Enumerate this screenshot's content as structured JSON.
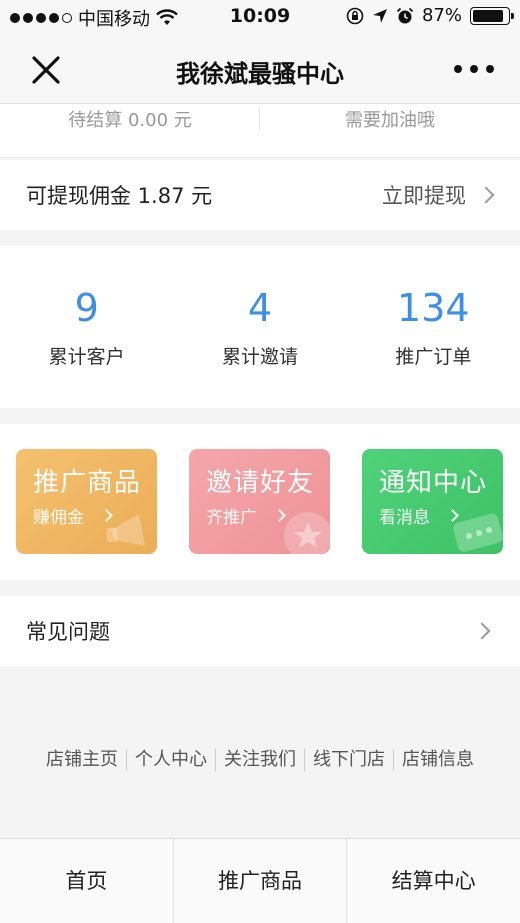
{
  "status_bar": {
    "carrier": "中国移动",
    "time": "10:09",
    "battery": "87%",
    "battery_level": 0.87
  },
  "nav": {
    "title": "我徐斌最骚中心"
  },
  "top_row": {
    "left_text": "待结算 0.00 元",
    "right_text": "需要加油哦"
  },
  "withdraw": {
    "label": "可提现佣金 1.87 元",
    "action": "立即提现"
  },
  "stats": [
    {
      "value": "9",
      "label": "累计客户"
    },
    {
      "value": "4",
      "label": "累计邀请"
    },
    {
      "value": "134",
      "label": "推广订单"
    }
  ],
  "cards": [
    {
      "title": "推广商品",
      "sub": "赚佣金",
      "color": "#efb760"
    },
    {
      "title": "邀请好友",
      "sub": "齐推广",
      "color": "#f29ca0"
    },
    {
      "title": "通知中心",
      "sub": "看消息",
      "color": "#46ca6f"
    }
  ],
  "faq": {
    "label": "常见问题"
  },
  "footer_links": [
    "店铺主页",
    "个人中心",
    "关注我们",
    "线下门店",
    "店铺信息"
  ],
  "tabs": [
    "首页",
    "推广商品",
    "结算中心"
  ],
  "colors": {
    "accent_blue": "#3d8ee6"
  }
}
